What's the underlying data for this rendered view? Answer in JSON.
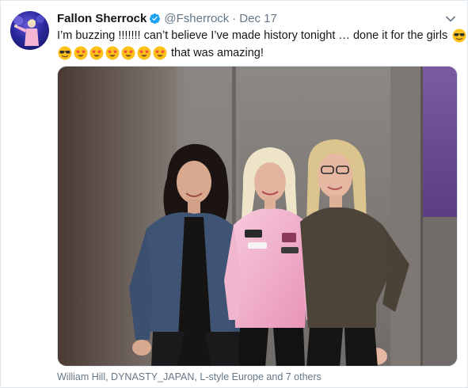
{
  "tweet": {
    "author": {
      "display_name": "Fallon Sherrock",
      "handle": "@Fsherrock",
      "verified": true,
      "verified_icon": "verified-badge-icon"
    },
    "separator": "·",
    "date": "Dec 17",
    "menu_icon": "chevron-down-icon",
    "text_line1": "I’m buzzing !!!!!!! can’t believe I’ve made history tonight … done it for the girls",
    "text_line2_suffix": "that was amazing!",
    "emoji": {
      "line1_end": "sunglasses-face",
      "line2_start": [
        "sunglasses-face",
        "star-struck-face",
        "star-struck-face",
        "star-struck-face",
        "star-struck-face",
        "star-struck-face",
        "star-struck-face"
      ]
    },
    "photo_tagged": "William Hill, DYNASTY_JAPAN, L-style Europe and 7 others"
  },
  "colors": {
    "text": "#14171a",
    "secondary": "#657786",
    "verified_blue": "#1da1f2",
    "border": "#e1e8ed"
  }
}
